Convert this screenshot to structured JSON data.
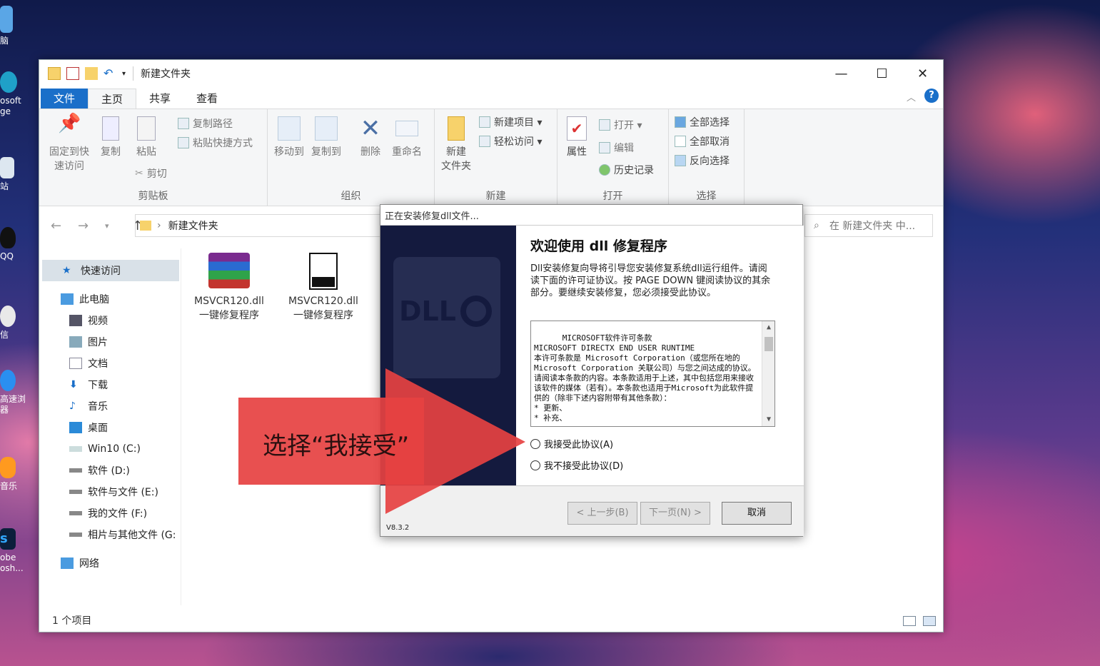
{
  "desktop": {
    "icons": [
      "脑",
      "osoft\nge",
      "站",
      "QQ",
      "信",
      "高速浏\n器",
      "音乐",
      "obe\nosh..."
    ]
  },
  "explorer": {
    "title": "新建文件夹",
    "window_buttons": {
      "minimize": "—",
      "maximize": "☐",
      "close": "✕"
    },
    "tabs": {
      "file": "文件",
      "home": "主页",
      "share": "共享",
      "view": "查看"
    },
    "ribbon": {
      "clipboard": {
        "label": "剪贴板",
        "pin": "固定到快\n速访问",
        "copy": "复制",
        "paste": "粘贴",
        "copy_path": "复制路径",
        "paste_shortcut": "粘贴快捷方式",
        "cut": "剪切"
      },
      "organize": {
        "label": "组织",
        "move_to": "移动到",
        "copy_to": "复制到",
        "delete": "删除",
        "rename": "重命名"
      },
      "new": {
        "label": "新建",
        "new_folder": "新建\n文件夹",
        "new_item": "新建项目 ▾",
        "easy_access": "轻松访问 ▾"
      },
      "open": {
        "label": "打开",
        "properties": "属性",
        "open": "打开 ▾",
        "edit": "编辑",
        "history": "历史记录"
      },
      "select": {
        "label": "选择",
        "select_all": "全部选择",
        "select_none": "全部取消",
        "invert": "反向选择"
      }
    },
    "address": {
      "path": "新建文件夹",
      "search_placeholder": "在 新建文件夹 中..."
    },
    "sidebar": {
      "quick_access": "快速访问",
      "this_pc": "此电脑",
      "videos": "视频",
      "pictures": "图片",
      "documents": "文档",
      "downloads": "下载",
      "music": "音乐",
      "desktop": "桌面",
      "c": "Win10 (C:)",
      "d": "软件 (D:)",
      "e": "软件与文件 (E:)",
      "f": "我的文件 (F:)",
      "g": "相片与其他文件 (G:",
      "network": "网络"
    },
    "files": [
      {
        "name": "MSVCR120.dll\n一键修复程序"
      },
      {
        "name": "MSVCR120.dll\n一键修复程序"
      }
    ],
    "status": "1 个项目"
  },
  "dialog": {
    "title": "正在安装修复dll文件...",
    "heading": "欢迎使用 dll 修复程序",
    "description": "Dll安装修复向导将引导您安装修复系统dll运行组件。请阅读下面的许可证协议。按 PAGE DOWN 键阅读协议的其余部分。要继续安装修复，您必须接受此协议。",
    "license_text": "MICROSOFT软件许可条款\nMICROSOFT DIRECTX END USER RUNTIME\n本许可条款是 Microsoft Corporation（或您所在地的 Microsoft Corporation 关联公司）与您之间达成的协议。请阅读本条款的内容。本条款适用于上述，其中包括您用来接收该软件的媒体（若有）。本条款也适用于Microsoft为此软件提供的（除非下述内容附带有其他条款）：\n* 更新、\n* 补充、",
    "accept": "我接受此协议(A)",
    "decline": "我不接受此协议(D)",
    "back": "< 上一步(B)",
    "next": "下一页(N) >",
    "cancel": "取消",
    "version": "V8.3.2",
    "banner_logo": "DLL"
  },
  "annotation": {
    "text": "选择“我接受”",
    "color": "#e64141"
  }
}
